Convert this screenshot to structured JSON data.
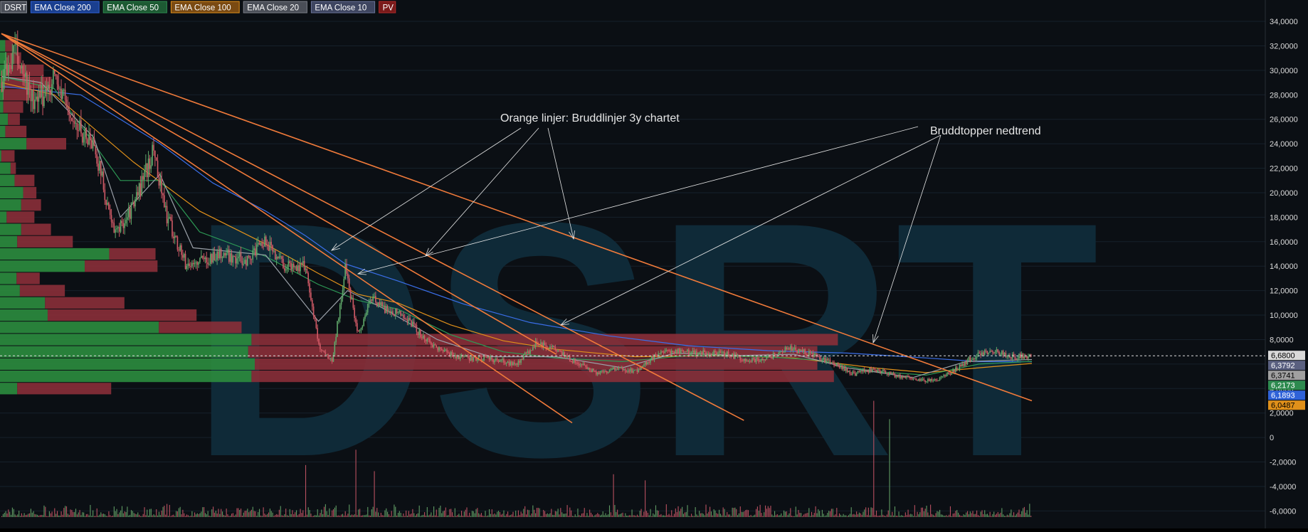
{
  "colors": {
    "background": "#0b0f14",
    "grid": "#16212b",
    "axis_text": "#dcdcdc",
    "candle_up": "#5fa86a",
    "candle_down": "#d05a66",
    "vp_buy": "#2b8a3e",
    "vp_sell": "#8a2f38",
    "volume_up": "#5f9a63",
    "volume_down": "#b85060",
    "trendline": "#f07a3a",
    "annotation": "#e6e6e6",
    "watermark": "#0f2a38"
  },
  "legend": [
    {
      "label": "DSRT",
      "bg": "#4a4e57",
      "border": "#8a8e96"
    },
    {
      "label": "EMA Close 200",
      "bg": "#1a3f8f",
      "border": "#2f62d8"
    },
    {
      "label": "EMA Close 50",
      "bg": "#1d5a33",
      "border": "#2d8a4f"
    },
    {
      "label": "EMA Close 100",
      "bg": "#7a4a12",
      "border": "#e0901a"
    },
    {
      "label": "EMA Close 20",
      "bg": "#4a4e57",
      "border": "#7a7e86"
    },
    {
      "label": "EMA Close 10",
      "bg": "#3e4560",
      "border": "#6a7398"
    },
    {
      "label": "PV",
      "bg": "#7a1a1a",
      "border": "#b02a2a"
    }
  ],
  "watermark": "DSRT",
  "annotations": [
    {
      "text": "Orange linjer: Bruddlinjer 3y chartet"
    },
    {
      "text": "Bruddtopper nedtrend"
    }
  ],
  "chart_data": {
    "type": "candlestick",
    "ylim": [
      -6.5,
      34.7
    ],
    "y_ticks": [
      "-6,0000",
      "-4,0000",
      "-2,0000",
      "0",
      "2,0000",
      "4,0000",
      "6,0000",
      "8,0000",
      "10,0000",
      "12,0000",
      "14,0000",
      "16,0000",
      "18,0000",
      "20,0000",
      "22,0000",
      "24,0000",
      "26,0000",
      "28,0000",
      "30,0000",
      "32,0000",
      "34,0000"
    ],
    "price_tags": [
      {
        "label": "6,6800",
        "value": 6.68,
        "bg": "#d9d9d9",
        "fg": "#000000"
      },
      {
        "label": "6,3792",
        "value": 6.3792,
        "bg": "#5a6080",
        "fg": "#ffffff"
      },
      {
        "label": "6,3741",
        "value": 6.3741,
        "bg": "#a0a0a0",
        "fg": "#000000"
      },
      {
        "label": "6,2173",
        "value": 6.2173,
        "bg": "#2d8a4f",
        "fg": "#ffffff"
      },
      {
        "label": "6,1893",
        "value": 6.1893,
        "bg": "#2f62d8",
        "fg": "#ffffff"
      },
      {
        "label": "6,0487",
        "value": 6.0487,
        "bg": "#e0901a",
        "fg": "#000000"
      }
    ],
    "current_price": 6.68,
    "n_bars": 780,
    "price_path": [
      [
        0,
        29
      ],
      [
        10,
        31.5
      ],
      [
        25,
        27
      ],
      [
        40,
        29.5
      ],
      [
        55,
        25.5
      ],
      [
        70,
        24
      ],
      [
        85,
        16.5
      ],
      [
        100,
        19
      ],
      [
        115,
        23.5
      ],
      [
        125,
        18
      ],
      [
        140,
        14
      ],
      [
        165,
        15
      ],
      [
        185,
        14.5
      ],
      [
        200,
        16
      ],
      [
        215,
        14
      ],
      [
        230,
        14
      ],
      [
        240,
        7.5
      ],
      [
        250,
        6.2
      ],
      [
        260,
        13.8
      ],
      [
        270,
        8.5
      ],
      [
        280,
        11.5
      ],
      [
        290,
        10.5
      ],
      [
        305,
        10
      ],
      [
        320,
        8
      ],
      [
        335,
        7
      ],
      [
        350,
        6.5
      ],
      [
        370,
        6.4
      ],
      [
        390,
        6.0
      ],
      [
        405,
        7.8
      ],
      [
        415,
        7.4
      ],
      [
        430,
        6.4
      ],
      [
        450,
        5.3
      ],
      [
        465,
        5.6
      ],
      [
        480,
        5.4
      ],
      [
        495,
        6.7
      ],
      [
        510,
        7.1
      ],
      [
        530,
        6.9
      ],
      [
        550,
        6.8
      ],
      [
        565,
        6.3
      ],
      [
        580,
        6.5
      ],
      [
        595,
        7.3
      ],
      [
        610,
        6.9
      ],
      [
        630,
        6.0
      ],
      [
        645,
        5.2
      ],
      [
        660,
        5.6
      ],
      [
        675,
        5.1
      ],
      [
        690,
        4.8
      ],
      [
        705,
        4.6
      ],
      [
        720,
        5.4
      ],
      [
        735,
        6.6
      ],
      [
        750,
        7.1
      ],
      [
        765,
        6.6
      ],
      [
        780,
        6.7
      ]
    ],
    "ema": [
      {
        "name": "EMA Close 200",
        "color": "#3a6ee8",
        "points": [
          [
            0,
            28.7
          ],
          [
            60,
            28
          ],
          [
            120,
            24
          ],
          [
            160,
            20.8
          ],
          [
            200,
            18.5
          ],
          [
            230,
            16.5
          ],
          [
            260,
            14.2
          ],
          [
            300,
            12.8
          ],
          [
            350,
            10.9
          ],
          [
            400,
            9.4
          ],
          [
            460,
            8.3
          ],
          [
            520,
            7.5
          ],
          [
            580,
            7.1
          ],
          [
            640,
            6.9
          ],
          [
            700,
            6.5
          ],
          [
            740,
            6.2
          ],
          [
            780,
            6.19
          ]
        ]
      },
      {
        "name": "EMA Close 100",
        "color": "#e0901a",
        "points": [
          [
            0,
            29
          ],
          [
            40,
            28
          ],
          [
            100,
            22.5
          ],
          [
            150,
            18.5
          ],
          [
            200,
            15.8
          ],
          [
            240,
            13.4
          ],
          [
            270,
            11.7
          ],
          [
            300,
            11
          ],
          [
            340,
            9.2
          ],
          [
            380,
            7.9
          ],
          [
            420,
            7.2
          ],
          [
            480,
            6.6
          ],
          [
            540,
            6.7
          ],
          [
            600,
            6.5
          ],
          [
            660,
            5.7
          ],
          [
            700,
            5.3
          ],
          [
            740,
            5.7
          ],
          [
            780,
            6.05
          ]
        ]
      },
      {
        "name": "EMA Close 50",
        "color": "#2d9a55",
        "points": [
          [
            0,
            29.5
          ],
          [
            40,
            28.5
          ],
          [
            90,
            21
          ],
          [
            120,
            21
          ],
          [
            150,
            16.8
          ],
          [
            200,
            14.8
          ],
          [
            240,
            12.5
          ],
          [
            270,
            11.2
          ],
          [
            300,
            10.5
          ],
          [
            340,
            8.4
          ],
          [
            380,
            7.0
          ],
          [
            420,
            6.5
          ],
          [
            470,
            6.2
          ],
          [
            520,
            6.7
          ],
          [
            580,
            6.6
          ],
          [
            620,
            6.3
          ],
          [
            660,
            5.4
          ],
          [
            700,
            5.1
          ],
          [
            740,
            6.0
          ],
          [
            780,
            6.22
          ]
        ]
      },
      {
        "name": "EMA Close 20",
        "color": "#9aa0a8",
        "points": [
          [
            0,
            29.5
          ],
          [
            30,
            29
          ],
          [
            70,
            24.5
          ],
          [
            90,
            18
          ],
          [
            120,
            21.5
          ],
          [
            145,
            15.5
          ],
          [
            200,
            14.9
          ],
          [
            240,
            9.5
          ],
          [
            262,
            12
          ],
          [
            290,
            10.5
          ],
          [
            330,
            8
          ],
          [
            370,
            6.6
          ],
          [
            420,
            6.6
          ],
          [
            470,
            5.7
          ],
          [
            510,
            6.9
          ],
          [
            560,
            6.7
          ],
          [
            600,
            6.8
          ],
          [
            640,
            5.7
          ],
          [
            690,
            4.9
          ],
          [
            730,
            6.2
          ],
          [
            780,
            6.37
          ]
        ]
      }
    ],
    "volume_profile": [
      {
        "price": 32.0,
        "buy": 8,
        "sell": 12
      },
      {
        "price": 31.0,
        "buy": 10,
        "sell": 22
      },
      {
        "price": 30.0,
        "buy": 8,
        "sell": 58
      },
      {
        "price": 29.0,
        "buy": 6,
        "sell": 72
      },
      {
        "price": 28.0,
        "buy": 5,
        "sell": 40
      },
      {
        "price": 27.0,
        "buy": 5,
        "sell": 30
      },
      {
        "price": 26.0,
        "buy": 12,
        "sell": 18
      },
      {
        "price": 25.0,
        "buy": 8,
        "sell": 32
      },
      {
        "price": 24.0,
        "buy": 40,
        "sell": 60
      },
      {
        "price": 23.0,
        "buy": 2,
        "sell": 20
      },
      {
        "price": 22.0,
        "buy": 16,
        "sell": 8
      },
      {
        "price": 21.0,
        "buy": 22,
        "sell": 30
      },
      {
        "price": 20.0,
        "buy": 35,
        "sell": 20
      },
      {
        "price": 19.0,
        "buy": 32,
        "sell": 30
      },
      {
        "price": 18.0,
        "buy": 10,
        "sell": 42
      },
      {
        "price": 17.0,
        "buy": 32,
        "sell": 45
      },
      {
        "price": 16.0,
        "buy": 26,
        "sell": 84
      },
      {
        "price": 15.0,
        "buy": 165,
        "sell": 70
      },
      {
        "price": 14.0,
        "buy": 128,
        "sell": 110
      },
      {
        "price": 13.0,
        "buy": 25,
        "sell": 35
      },
      {
        "price": 12.0,
        "buy": 30,
        "sell": 68
      },
      {
        "price": 11.0,
        "buy": 68,
        "sell": 120
      },
      {
        "price": 10.0,
        "buy": 72,
        "sell": 225
      },
      {
        "price": 9.0,
        "buy": 240,
        "sell": 125
      },
      {
        "price": 8.0,
        "buy": 380,
        "sell": 886
      },
      {
        "price": 7.0,
        "buy": 375,
        "sell": 860
      },
      {
        "price": 6.0,
        "buy": 385,
        "sell": 850
      },
      {
        "price": 5.0,
        "buy": 380,
        "sell": 880
      },
      {
        "price": 4.0,
        "buy": 26,
        "sell": 142
      }
    ],
    "trendlines": [
      {
        "x1": 0,
        "y1": 33.0,
        "x2": 432,
        "y2": 1.2
      },
      {
        "x1": 0,
        "y1": 33.0,
        "x2": 562,
        "y2": 1.4
      },
      {
        "x1": 0,
        "y1": 33.0,
        "x2": 780,
        "y2": 3.0
      },
      {
        "x1": 0,
        "y1": 33.0,
        "x2": 420,
        "y2": 6.8
      }
    ],
    "volume_spikes": [
      {
        "x": 660,
        "v": 19
      },
      {
        "x": 672,
        "v": 16
      },
      {
        "x": 268,
        "v": 11
      },
      {
        "x": 230,
        "v": 8.5
      },
      {
        "x": 282,
        "v": 7.5
      },
      {
        "x": 463,
        "v": 7
      },
      {
        "x": 487,
        "v": 6
      }
    ]
  }
}
